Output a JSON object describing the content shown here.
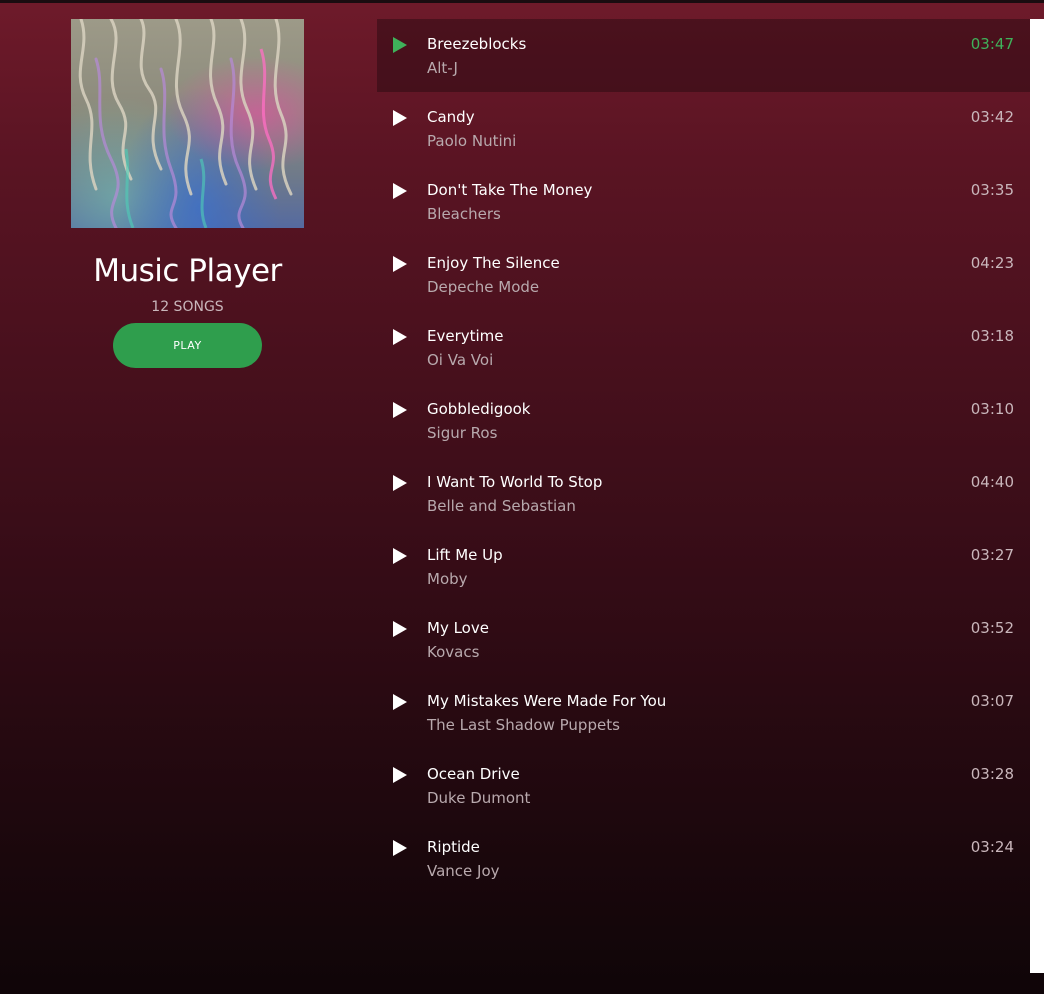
{
  "app": {
    "title": "Music Player",
    "song_count": "12 SONGS",
    "play_label": "PLAY",
    "accent_color": "#2f9e4d"
  },
  "album_art": {
    "icon": "album-cover-image"
  },
  "tracks": [
    {
      "title": "Breezeblocks",
      "artist": "Alt-J",
      "duration": "03:47",
      "active": true
    },
    {
      "title": "Candy",
      "artist": "Paolo Nutini",
      "duration": "03:42",
      "active": false
    },
    {
      "title": "Don't Take The Money",
      "artist": "Bleachers",
      "duration": "03:35",
      "active": false
    },
    {
      "title": "Enjoy The Silence",
      "artist": "Depeche Mode",
      "duration": "04:23",
      "active": false
    },
    {
      "title": "Everytime",
      "artist": "Oi Va Voi",
      "duration": "03:18",
      "active": false
    },
    {
      "title": "Gobbledigook",
      "artist": "Sigur Ros",
      "duration": "03:10",
      "active": false
    },
    {
      "title": "I Want To World To Stop",
      "artist": "Belle and Sebastian",
      "duration": "04:40",
      "active": false
    },
    {
      "title": "Lift Me Up",
      "artist": "Moby",
      "duration": "03:27",
      "active": false
    },
    {
      "title": "My Love",
      "artist": "Kovacs",
      "duration": "03:52",
      "active": false
    },
    {
      "title": "My Mistakes Were Made For You",
      "artist": "The Last Shadow Puppets",
      "duration": "03:07",
      "active": false
    },
    {
      "title": "Ocean Drive",
      "artist": "Duke Dumont",
      "duration": "03:28",
      "active": false
    },
    {
      "title": "Riptide",
      "artist": "Vance Joy",
      "duration": "03:24",
      "active": false
    }
  ]
}
